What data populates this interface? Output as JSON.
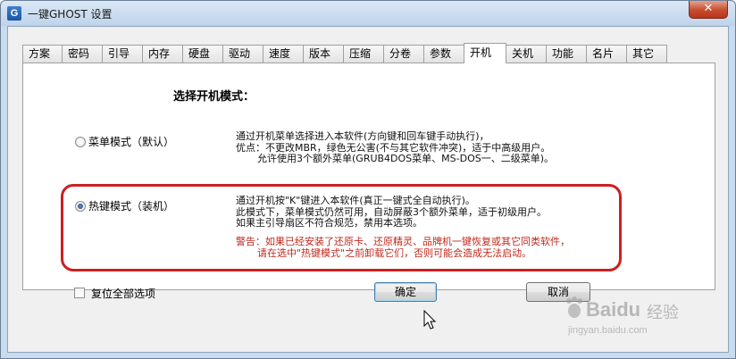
{
  "window": {
    "title": "一键GHOST 设置",
    "app_icon_letter": "G",
    "close_glyph": "✕"
  },
  "tabs": [
    {
      "label": "方案",
      "active": false
    },
    {
      "label": "密码",
      "active": false
    },
    {
      "label": "引导",
      "active": false
    },
    {
      "label": "内存",
      "active": false
    },
    {
      "label": "硬盘",
      "active": false
    },
    {
      "label": "驱动",
      "active": false
    },
    {
      "label": "速度",
      "active": false
    },
    {
      "label": "版本",
      "active": false
    },
    {
      "label": "压缩",
      "active": false
    },
    {
      "label": "分卷",
      "active": false
    },
    {
      "label": "参数",
      "active": false
    },
    {
      "label": "开机",
      "active": true
    },
    {
      "label": "关机",
      "active": false
    },
    {
      "label": "功能",
      "active": false
    },
    {
      "label": "名片",
      "active": false
    },
    {
      "label": "其它",
      "active": false
    }
  ],
  "panel": {
    "heading": "选择开机模式：",
    "options": [
      {
        "label": "菜单模式（默认）",
        "selected": false,
        "desc": [
          "通过开机菜单选择进入本软件(方向键和回车键手动执行)，",
          "优点：不更改MBR，绿色无公害(不与其它软件冲突)，适于中高级用户。",
          "允许使用3个额外菜单(GRUB4DOS菜单、MS-DOS一、二级菜单)。"
        ]
      },
      {
        "label": "热键模式（装机）",
        "selected": true,
        "desc": [
          "通过开机按\"K\"键进入本软件(真正一键式全自动执行)。",
          "此模式下，菜单模式仍然可用，自动屏蔽3个额外菜单，适于初级用户。",
          "如果主引导扇区不符合规范，禁用本选项。"
        ],
        "warning": [
          "警告：如果已经安装了还原卡、还原精灵、品牌机一键恢复或其它同类软件，",
          "请在选中\"热键模式\"之前卸载它们，否则可能会造成无法启动。"
        ]
      }
    ]
  },
  "footer": {
    "reset_label": "复位全部选项",
    "ok_label": "确定",
    "cancel_label": "取消"
  },
  "watermark": {
    "brand": "Baidu",
    "brand_cn": "经验",
    "url": "jingyan.baidu.com"
  },
  "colors": {
    "highlight_border": "#cc1f1f",
    "warning_text": "#c0281c",
    "window_frame": "#c9dcef"
  }
}
